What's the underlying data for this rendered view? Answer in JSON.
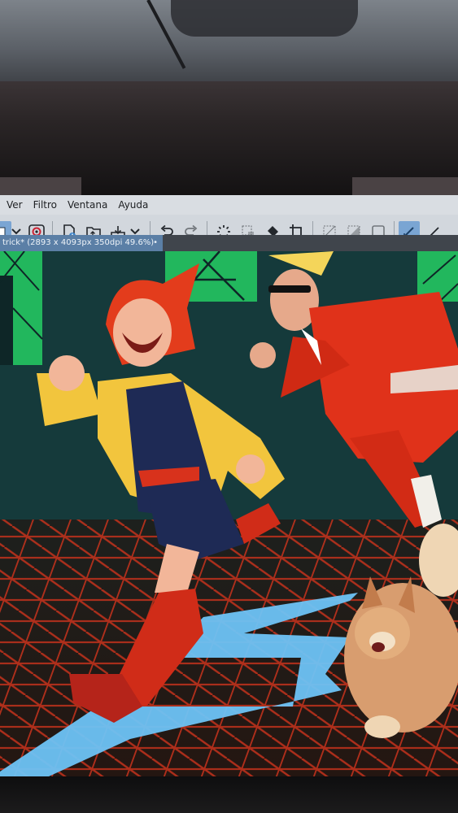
{
  "menu": {
    "items": [
      "Ver",
      "Filtro",
      "Ventana",
      "Ayuda"
    ]
  },
  "toolbar": {
    "icons": [
      "layer-icon",
      "chevron-down-icon",
      "record-icon",
      "new-file-icon",
      "open-folder-icon",
      "save-icon",
      "chevron-down-icon",
      "undo-icon",
      "redo-icon",
      "loading-icon",
      "transform-icon",
      "fill-icon",
      "crop-icon",
      "select-none-icon",
      "select-invert-icon",
      "frame-icon",
      "pen-icon",
      "brush-icon"
    ]
  },
  "document": {
    "tab_title": "trick* (2893 x 4093px 350dpi 49.6%)",
    "modified_dot": "•"
  },
  "colors": {
    "menubar": "#d9dde2",
    "toolbar": "#d2d7dd",
    "tab_active": "#5b7fa6",
    "canvas_bg": "#14393a",
    "grid_red": "#c8321c",
    "floor_line": "#6ec3f5",
    "jacket_yellow": "#f2c53d",
    "suit_red": "#e0321a"
  }
}
